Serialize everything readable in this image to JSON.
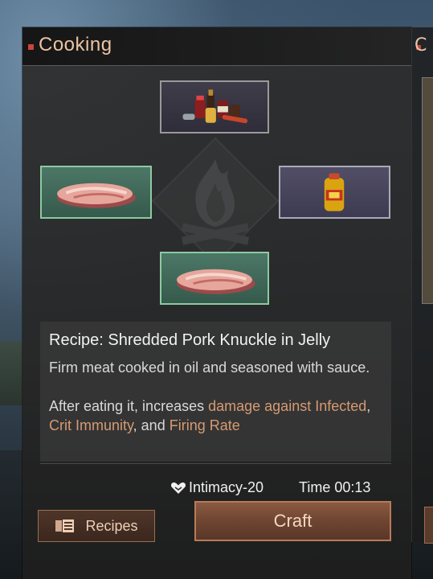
{
  "panel": {
    "title": "Cooking"
  },
  "right_panel": {
    "title_partial": "C"
  },
  "ingredients": [
    {
      "slot": "top",
      "icon": "condiments-icon"
    },
    {
      "slot": "left",
      "icon": "raw-meat-icon"
    },
    {
      "slot": "right",
      "icon": "cooking-oil-icon"
    },
    {
      "slot": "bottom",
      "icon": "raw-meat-icon"
    }
  ],
  "recipe": {
    "title": "Recipe: Shredded Pork Knuckle in Jelly",
    "description": "Firm meat cooked in oil and seasoned with sauce.",
    "effect_prefix": "After eating it, increases ",
    "effect_1": "damage against Infected",
    "effect_sep_1": ", ",
    "effect_2": "Crit Immunity",
    "effect_sep_2": ", and ",
    "effect_3": "Firing Rate"
  },
  "stats": {
    "intimacy": "Intimacy-20",
    "time": "Time 00:13"
  },
  "buttons": {
    "recipes": "Recipes",
    "craft": "Craft"
  },
  "colors": {
    "accent": "#d69a72",
    "title": "#ecc3a3",
    "craft_button": "#6e4532",
    "highlight_slot": "#8ec9a2"
  }
}
